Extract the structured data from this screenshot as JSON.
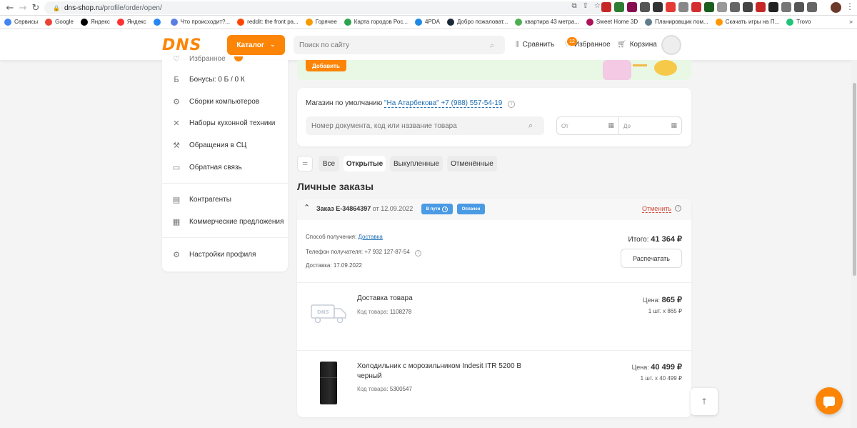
{
  "browser": {
    "url_host": "dns-shop.ru",
    "url_path": "/profile/order/open/",
    "bookmarks": [
      {
        "label": "Сервисы",
        "color": "#4285f4"
      },
      {
        "label": "Google",
        "color": "#ea4335"
      },
      {
        "label": "Яндекс",
        "color": "#000000"
      },
      {
        "label": "Яндекс",
        "color": "#f33"
      },
      {
        "label": "",
        "color": "#2787f5"
      },
      {
        "label": "Что происходит?...",
        "color": "#5b7fde"
      },
      {
        "label": "reddit: the front pa...",
        "color": "#ff4500"
      },
      {
        "label": "Горячее",
        "color": "#f59b00"
      },
      {
        "label": "Карта городов Рос...",
        "color": "#2ea44f"
      },
      {
        "label": "4PDA",
        "color": "#1e88e5"
      },
      {
        "label": "Добро пожаловат...",
        "color": "#1b2838"
      },
      {
        "label": "квартира 43 метра...",
        "color": "#4caf50"
      },
      {
        "label": "Sweet Home 3D",
        "color": "#ad1457"
      },
      {
        "label": "Планировщик пом...",
        "color": "#607d8b"
      },
      {
        "label": "Скачать игры на П...",
        "color": "#ff9800"
      },
      {
        "label": "Trovo",
        "color": "#21c37a"
      }
    ],
    "bookmarks_more": "»"
  },
  "header": {
    "logo": "DNS",
    "catalog_label": "Каталог",
    "search_placeholder": "Поиск по сайту",
    "compare_label": "Сравнить",
    "favorites_label": "Избранное",
    "favorites_count": "12",
    "cart_label": "Корзина"
  },
  "sidebar": {
    "items": [
      {
        "label": "Избранное",
        "icon": "heart-icon"
      },
      {
        "label": "Бонусы: 0 Б / 0 К",
        "icon": "bonus-icon"
      },
      {
        "label": "Сборки компьютеров",
        "icon": "chip-icon"
      },
      {
        "label": "Наборы кухонной техники",
        "icon": "kitchen-icon"
      },
      {
        "label": "Обращения в СЦ",
        "icon": "wrench-icon"
      },
      {
        "label": "Обратная связь",
        "icon": "feedback-icon"
      },
      {
        "label": "Контрагенты",
        "icon": "briefcase-icon"
      },
      {
        "label": "Коммерческие предложения",
        "icon": "document-icon"
      },
      {
        "label": "Настройки профиля",
        "icon": "gear-icon"
      }
    ]
  },
  "promo": {
    "button_label": "Добавить"
  },
  "filter": {
    "store_prefix": "Магазин по умолчанию",
    "store_link": "\"На Атарбекова\" +7 (988) 557-54-19",
    "doc_placeholder": "Номер документа, код или название товара",
    "date_from": "От",
    "date_to": "До"
  },
  "tabs": [
    {
      "label": "Все",
      "active": false
    },
    {
      "label": "Открытые",
      "active": true
    },
    {
      "label": "Выкупленные",
      "active": false
    },
    {
      "label": "Отменённые",
      "active": false
    }
  ],
  "section_title": "Личные заказы",
  "order": {
    "title": "Заказ Е-34864397",
    "date": "от 12.09.2022",
    "status_way": "В пути",
    "status_paid": "Оплачен",
    "cancel_label": "Отменить",
    "delivery_method_label": "Способ получения:",
    "delivery_method_value": "Доставка",
    "phone_label": "Телефон получателя:",
    "phone_value": "+7 932 127-87-54",
    "delivery_date_label": "Доставка:",
    "delivery_date_value": "17.09.2022",
    "total_label": "Итого:",
    "total_value": "41 364 ₽",
    "print_label": "Распечатать",
    "items": [
      {
        "name": "Доставка товара",
        "code_label": "Код товара:",
        "code": "1108278",
        "price_label": "Цена:",
        "price": "865 ₽",
        "qty": "1 шт. х 865 ₽"
      },
      {
        "name": "Холодильник с морозильником Indesit ITR 5200 B черный",
        "code_label": "Код товара:",
        "code": "5300547",
        "price_label": "Цена:",
        "price": "40 499 ₽",
        "qty": "1 шт. х 40 499 ₽"
      }
    ]
  },
  "colors": {
    "brand": "#fc8507",
    "link": "#1e6fb4",
    "badge_blue": "#4a9ae4",
    "cancel_red": "#d04b3a"
  }
}
